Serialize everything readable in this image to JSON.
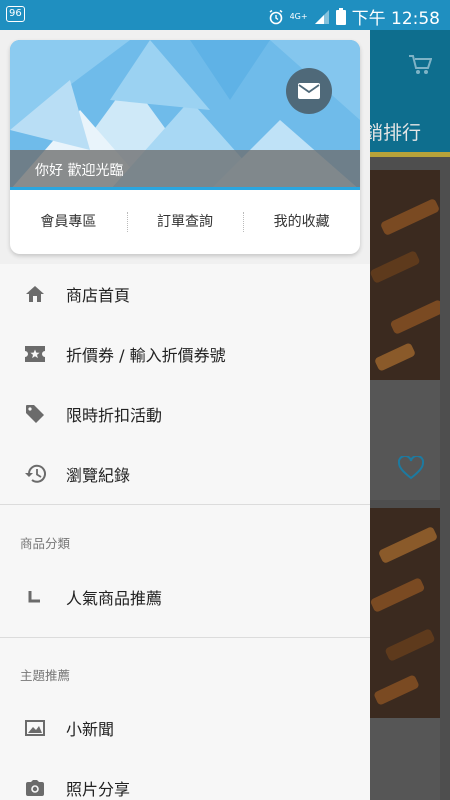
{
  "status_bar": {
    "left_badge": "96",
    "network": "4G+",
    "time": "下午 12:58"
  },
  "drawer": {
    "greeting": "你好 歡迎光臨",
    "quick_links": [
      "會員專區",
      "訂單查詢",
      "我的收藏"
    ],
    "menu": [
      {
        "label": "商店首頁",
        "icon": "home-icon"
      },
      {
        "label": "折價券 / 輸入折價券號",
        "icon": "coupon-icon"
      },
      {
        "label": "限時折扣活動",
        "icon": "tag-icon"
      },
      {
        "label": "瀏覽紀錄",
        "icon": "history-icon"
      }
    ],
    "section_categories": "商品分類",
    "category_items": [
      {
        "label": "人氣商品推薦",
        "icon": "subcategory-icon"
      }
    ],
    "section_topics": "主題推薦",
    "topic_items": [
      {
        "label": "小新聞",
        "icon": "image-icon"
      },
      {
        "label": "照片分享",
        "icon": "camera-icon"
      }
    ]
  },
  "background": {
    "ranking_label": "銷排行"
  },
  "colors": {
    "status_bar": "#1f8fc0",
    "hero_sky": "#72bde9",
    "accent_line": "#2aa6e0",
    "mail_button": "#4f6979",
    "icon_gray": "#6b6b6b"
  }
}
